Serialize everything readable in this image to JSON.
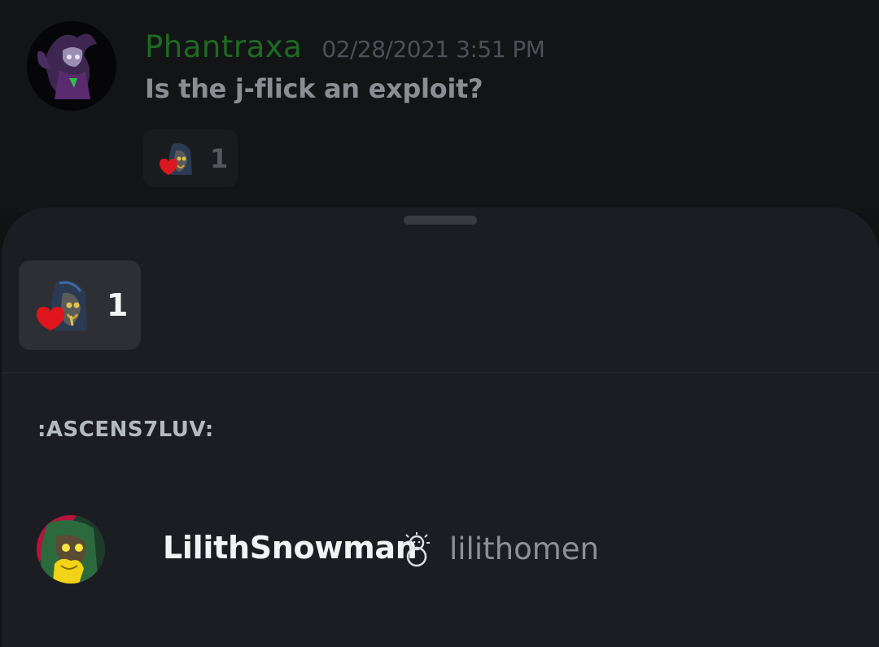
{
  "message": {
    "author": "Phantraxa",
    "timestamp": "02/28/2021 3:51 PM",
    "text": "Is the j-flick an exploit?",
    "reaction": {
      "emoji_icon": "ascens7luv-emoji-icon",
      "count": "1"
    }
  },
  "reactions_sheet": {
    "tabs": [
      {
        "emoji_icon": "ascens7luv-emoji-icon",
        "count": "1"
      }
    ],
    "emoji_name": ":ASCENS7LUV:",
    "users": [
      {
        "display_name": "LilithSnowman",
        "badge_icon": "snowman-icon",
        "username": "lilithomen"
      }
    ]
  },
  "colors": {
    "author_name": "#1e6a23",
    "sheet_background": "#1c1d22",
    "tab_active": "#2e2f35"
  }
}
